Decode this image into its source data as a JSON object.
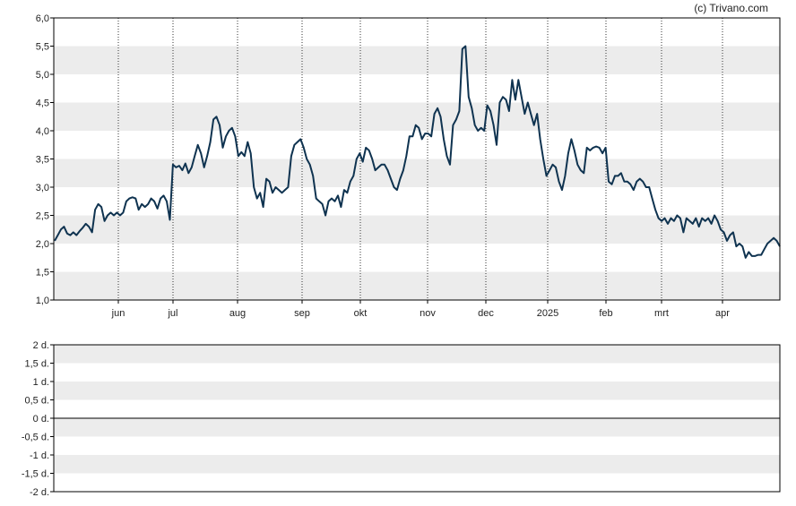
{
  "credit": "(c) Trivano.com",
  "chart_data": [
    {
      "type": "line",
      "grid": true,
      "ylim": [
        1.0,
        6.0
      ],
      "y_ticks": [
        "6,0",
        "5,5",
        "5,0",
        "4,5",
        "4,0",
        "3,5",
        "3,0",
        "2,5",
        "2,0",
        "1,5",
        "1,0"
      ],
      "x_ticks": [
        "jun",
        "jul",
        "aug",
        "sep",
        "okt",
        "nov",
        "dec",
        "2025",
        "feb",
        "mrt",
        "apr"
      ],
      "line_color": "#0f3350",
      "series": [
        {
          "values": [
            2.05,
            2.15,
            2.25,
            2.3,
            2.18,
            2.15,
            2.2,
            2.15,
            2.22,
            2.28,
            2.35,
            2.3,
            2.2,
            2.6,
            2.7,
            2.65,
            2.4,
            2.5,
            2.55,
            2.5,
            2.55,
            2.5,
            2.55,
            2.75,
            2.8,
            2.82,
            2.8,
            2.6,
            2.7,
            2.65,
            2.7,
            2.8,
            2.75,
            2.62,
            2.8,
            2.85,
            2.75,
            2.42,
            3.4,
            3.35,
            3.38,
            3.3,
            3.42,
            3.25,
            3.35,
            3.55,
            3.75,
            3.6,
            3.35,
            3.55,
            3.8,
            4.2,
            4.25,
            4.1,
            3.7,
            3.9,
            4.0,
            4.05,
            3.9,
            3.55,
            3.62,
            3.55,
            3.8,
            3.6,
            3.0,
            2.8,
            2.9,
            2.65,
            3.15,
            3.1,
            2.9,
            3.0,
            2.95,
            2.9,
            2.95,
            3.0,
            3.55,
            3.75,
            3.8,
            3.85,
            3.7,
            3.5,
            3.4,
            3.2,
            2.8,
            2.75,
            2.7,
            2.5,
            2.75,
            2.8,
            2.75,
            2.85,
            2.65,
            2.95,
            2.9,
            3.1,
            3.2,
            3.5,
            3.6,
            3.45,
            3.7,
            3.65,
            3.5,
            3.3,
            3.35,
            3.4,
            3.4,
            3.3,
            3.15,
            3.0,
            2.95,
            3.15,
            3.3,
            3.55,
            3.9,
            3.9,
            4.1,
            4.05,
            3.85,
            3.95,
            3.95,
            3.9,
            4.3,
            4.4,
            4.25,
            3.85,
            3.55,
            3.4,
            4.1,
            4.2,
            4.35,
            5.45,
            5.5,
            4.6,
            4.4,
            4.1,
            4.0,
            4.05,
            4.0,
            4.45,
            4.35,
            4.1,
            3.75,
            4.5,
            4.6,
            4.55,
            4.35,
            4.9,
            4.55,
            4.9,
            4.6,
            4.3,
            4.5,
            4.3,
            4.1,
            4.3,
            3.85,
            3.5,
            3.2,
            3.3,
            3.4,
            3.35,
            3.1,
            2.95,
            3.2,
            3.6,
            3.85,
            3.65,
            3.4,
            3.3,
            3.25,
            3.7,
            3.65,
            3.7,
            3.72,
            3.7,
            3.6,
            3.7,
            3.1,
            3.05,
            3.2,
            3.2,
            3.25,
            3.1,
            3.1,
            3.05,
            2.95,
            3.1,
            3.15,
            3.1,
            3.0,
            3.0,
            2.8,
            2.6,
            2.45,
            2.4,
            2.45,
            2.35,
            2.45,
            2.4,
            2.5,
            2.45,
            2.2,
            2.45,
            2.4,
            2.35,
            2.45,
            2.3,
            2.45,
            2.4,
            2.45,
            2.35,
            2.5,
            2.4,
            2.25,
            2.2,
            2.05,
            2.15,
            2.2,
            1.95,
            2.0,
            1.95,
            1.75,
            1.85,
            1.78,
            1.78,
            1.8,
            1.8,
            1.9,
            2.0,
            2.05,
            2.1,
            2.05,
            1.95
          ]
        }
      ]
    },
    {
      "type": "line",
      "grid": true,
      "ylim": [
        -2,
        2
      ],
      "y_ticks": [
        "2 d.",
        "1,5 d.",
        "1 d.",
        "0,5 d.",
        "0 d.",
        "-0,5 d.",
        "-1 d.",
        "-1,5 d.",
        "-2 d."
      ],
      "series": []
    }
  ]
}
